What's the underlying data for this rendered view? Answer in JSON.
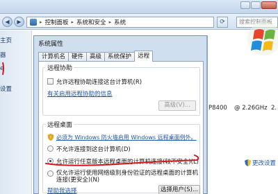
{
  "window": {
    "address": {
      "root_label": "控制面板",
      "crumb_1": "系统和安全",
      "crumb_2": "系统"
    },
    "search_placeholder": "搜索控制面板"
  },
  "left_pane": {
    "items": [
      "主页",
      "器",
      "e",
      "设置"
    ]
  },
  "right_pane": {
    "cpu_model": "P8400",
    "cpu_speed": "@ 2.26GHz",
    "cpu_speed_2": "2.",
    "change_settings": "更改设置"
  },
  "dialog": {
    "title": "系统属性",
    "tabs": [
      "计算机名",
      "硬件",
      "高级",
      "系统保护",
      "远程"
    ],
    "active_tab": "远程",
    "remote_assistance": {
      "heading": "远程协助",
      "allow_label": "允许远程协助连接这台计算机(R)",
      "allow_checked": false,
      "help_link": "有关启用远程协助的信息",
      "advanced_button": "高级(V)..."
    },
    "remote_desktop": {
      "heading": "远程桌面",
      "firewall_link": "必须为 Windows 防火墙启用 Windows 远程桌面例外。",
      "options": [
        {
          "label": "不允许连接到这台计算机(D)",
          "checked": false
        },
        {
          "label": "允许运行任意版本远程桌面的计算机连接(较不安全)(L)",
          "checked": true
        },
        {
          "label": "仅允许运行使用网络级别身份验证的远程桌面的计算机连接(更安全)(N)",
          "checked": false
        }
      ],
      "help_choose_link": "帮助我选择",
      "select_users_button": "选择用户(S)..."
    }
  },
  "colors": {
    "annotation_red": "#d8161b",
    "link_blue": "#1f56a8",
    "dialog_frame": "#cfdff0"
  }
}
